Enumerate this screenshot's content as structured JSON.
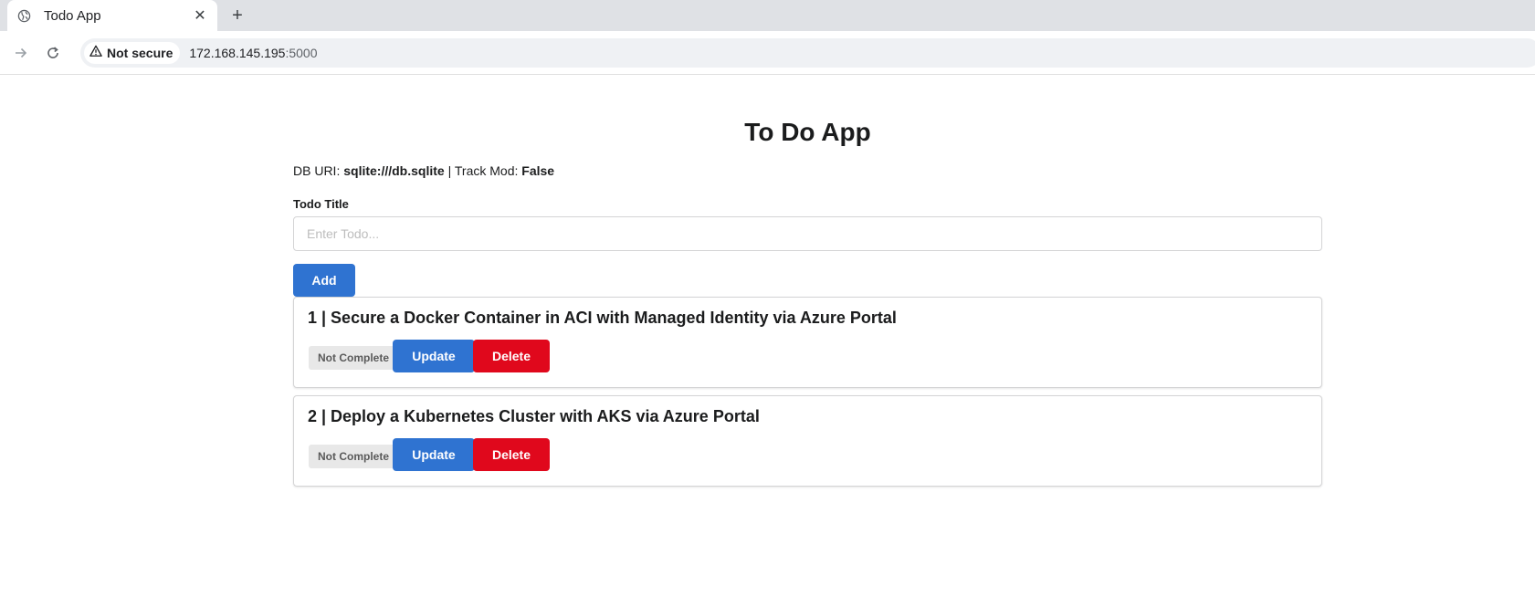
{
  "browser": {
    "tab_title": "Todo App",
    "tab_favicon": "globe-icon",
    "close_glyph": "✕",
    "newtab_glyph": "+",
    "security_label": "Not secure",
    "url_host": "172.168.145.195",
    "url_port": ":5000"
  },
  "app": {
    "title": "To Do App",
    "db_uri_label": "DB URI:",
    "db_uri_value": "sqlite:///db.sqlite",
    "separator": "|",
    "track_mod_label": "Track Mod:",
    "track_mod_value": "False",
    "field_label": "Todo Title",
    "input_value": "",
    "input_placeholder": "Enter Todo...",
    "add_label": "Add"
  },
  "todos": [
    {
      "title": "1 | Secure a Docker Container in ACI with Managed Identity via Azure Portal",
      "status": "Not Complete",
      "update_label": "Update",
      "delete_label": "Delete"
    },
    {
      "title": "2 | Deploy a Kubernetes Cluster with AKS via Azure Portal",
      "status": "Not Complete",
      "update_label": "Update",
      "delete_label": "Delete"
    }
  ],
  "colors": {
    "primary": "#2f73d1",
    "danger": "#e0081c",
    "status_bg": "#e8e8e8"
  }
}
